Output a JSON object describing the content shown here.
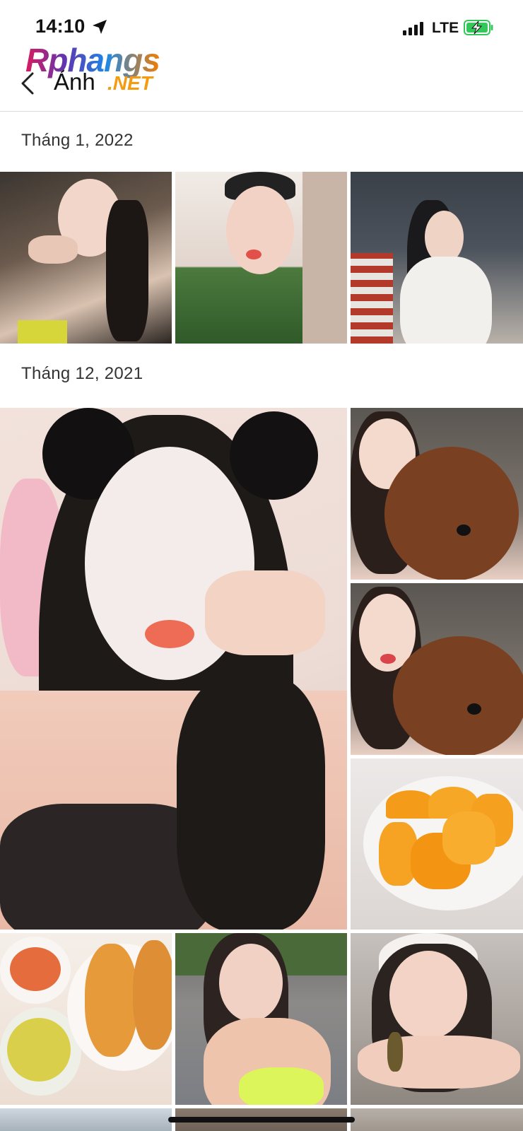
{
  "status_bar": {
    "time": "14:10",
    "network": "LTE",
    "location_icon": "location-arrow-icon",
    "signal_icon": "cellular-signal-icon",
    "battery_icon": "battery-charging-icon",
    "battery_color": "#34c759"
  },
  "header": {
    "title": "Ảnh",
    "back_icon": "chevron-left-icon"
  },
  "watermark": {
    "line1": "Rphangs",
    "line2": ".NET"
  },
  "sections": [
    {
      "label": "Tháng 1, 2022",
      "photo_count": 3
    },
    {
      "label": "Tháng 12, 2021",
      "photo_count": 7
    }
  ],
  "photos": [
    {
      "name": "photo-selfie-restaurant"
    },
    {
      "name": "photo-selfie-green-shirt"
    },
    {
      "name": "photo-woman-white-shirt"
    },
    {
      "name": "photo-face-mask-selfie"
    },
    {
      "name": "photo-selfie-poodle-1"
    },
    {
      "name": "photo-selfie-poodle-2"
    },
    {
      "name": "photo-orange-slices"
    },
    {
      "name": "photo-bread-breakfast"
    },
    {
      "name": "photo-pool-selfie"
    },
    {
      "name": "photo-selfie-bracelet"
    }
  ]
}
